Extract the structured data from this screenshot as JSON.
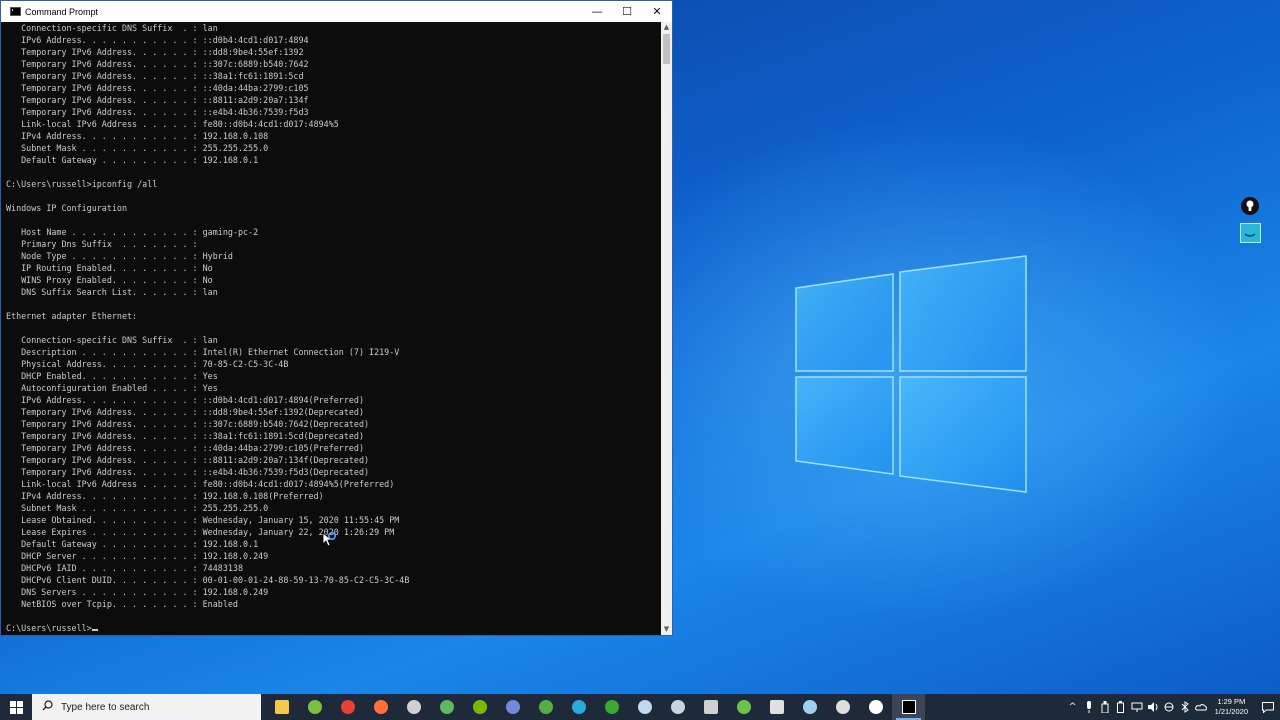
{
  "window": {
    "title": "Command Prompt",
    "minimize_glyph": "—",
    "maximize_glyph": "☐",
    "close_glyph": "✕"
  },
  "console_lines": [
    "   Connection-specific DNS Suffix  . : lan",
    "   IPv6 Address. . . . . . . . . . . : ::d0b4:4cd1:d017:4894",
    "   Temporary IPv6 Address. . . . . . : ::dd8:9be4:55ef:1392",
    "   Temporary IPv6 Address. . . . . . : ::307c:6889:b540:7642",
    "   Temporary IPv6 Address. . . . . . : ::38a1:fc61:1891:5cd",
    "   Temporary IPv6 Address. . . . . . : ::40da:44ba:2799:c105",
    "   Temporary IPv6 Address. . . . . . : ::8811:a2d9:20a7:134f",
    "   Temporary IPv6 Address. . . . . . : ::e4b4:4b36:7539:f5d3",
    "   Link-local IPv6 Address . . . . . : fe80::d0b4:4cd1:d017:4894%5",
    "   IPv4 Address. . . . . . . . . . . : 192.168.0.108",
    "   Subnet Mask . . . . . . . . . . . : 255.255.255.0",
    "   Default Gateway . . . . . . . . . : 192.168.0.1",
    "",
    "C:\\Users\\russell>ipconfig /all",
    "",
    "Windows IP Configuration",
    "",
    "   Host Name . . . . . . . . . . . . : gaming-pc-2",
    "   Primary Dns Suffix  . . . . . . . :",
    "   Node Type . . . . . . . . . . . . : Hybrid",
    "   IP Routing Enabled. . . . . . . . : No",
    "   WINS Proxy Enabled. . . . . . . . : No",
    "   DNS Suffix Search List. . . . . . : lan",
    "",
    "Ethernet adapter Ethernet:",
    "",
    "   Connection-specific DNS Suffix  . : lan",
    "   Description . . . . . . . . . . . : Intel(R) Ethernet Connection (7) I219-V",
    "   Physical Address. . . . . . . . . : 70-85-C2-C5-3C-4B",
    "   DHCP Enabled. . . . . . . . . . . : Yes",
    "   Autoconfiguration Enabled . . . . : Yes",
    "   IPv6 Address. . . . . . . . . . . : ::d0b4:4cd1:d017:4894(Preferred)",
    "   Temporary IPv6 Address. . . . . . : ::dd8:9be4:55ef:1392(Deprecated)",
    "   Temporary IPv6 Address. . . . . . : ::307c:6889:b540:7642(Deprecated)",
    "   Temporary IPv6 Address. . . . . . : ::38a1:fc61:1891:5cd(Deprecated)",
    "   Temporary IPv6 Address. . . . . . : ::40da:44ba:2799:c105(Preferred)",
    "   Temporary IPv6 Address. . . . . . : ::8811:a2d9:20a7:134f(Deprecated)",
    "   Temporary IPv6 Address. . . . . . : ::e4b4:4b36:7539:f5d3(Deprecated)",
    "   Link-local IPv6 Address . . . . . : fe80::d0b4:4cd1:d017:4894%5(Preferred)",
    "   IPv4 Address. . . . . . . . . . . : 192.168.0.108(Preferred)",
    "   Subnet Mask . . . . . . . . . . . : 255.255.255.0",
    "   Lease Obtained. . . . . . . . . . : Wednesday, January 15, 2020 11:55:45 PM",
    "   Lease Expires . . . . . . . . . . : Wednesday, January 22, 2020 1:26:29 PM",
    "   Default Gateway . . . . . . . . . : 192.168.0.1",
    "   DHCP Server . . . . . . . . . . . : 192.168.0.249",
    "   DHCPv6 IAID . . . . . . . . . . . : 74483138",
    "   DHCPv6 Client DUID. . . . . . . . : 00-01-00-01-24-88-59-13-70-85-C2-C5-3C-4B",
    "   DNS Servers . . . . . . . . . . . : 192.168.0.249",
    "   NetBIOS over Tcpip. . . . . . . . : Enabled",
    "",
    "C:\\Users\\russell>"
  ],
  "taskbar": {
    "search_placeholder": "Type here to search",
    "apps": [
      {
        "name": "file-explorer-icon",
        "color": "#f2c94c"
      },
      {
        "name": "notepad-plus-icon",
        "color": "#7bc043"
      },
      {
        "name": "chrome-icon",
        "color": "#e94235"
      },
      {
        "name": "firefox-icon",
        "color": "#ff7139"
      },
      {
        "name": "obs-icon",
        "color": "#d0d0d0"
      },
      {
        "name": "text-editor-icon",
        "color": "#5fb85f"
      },
      {
        "name": "nvidia-icon",
        "color": "#76b900"
      },
      {
        "name": "discord-icon",
        "color": "#7289da"
      },
      {
        "name": "xbox-icon",
        "color": "#52b043"
      },
      {
        "name": "g-app-icon",
        "color": "#2aa8e0"
      },
      {
        "name": "green-app-icon",
        "color": "#3aaa35"
      },
      {
        "name": "affinity-icon",
        "color": "#c0d8f0"
      },
      {
        "name": "steam-icon",
        "color": "#c6d4df"
      },
      {
        "name": "printer-icon",
        "color": "#d0d0d0"
      },
      {
        "name": "leaf-app-icon",
        "color": "#6cc24a"
      },
      {
        "name": "display-icon",
        "color": "#e0e0e0"
      },
      {
        "name": "globe-app-icon",
        "color": "#9fd0ef"
      },
      {
        "name": "unity-icon",
        "color": "#dddddd"
      },
      {
        "name": "keyhole-app-icon",
        "color": "#ffffff"
      },
      {
        "name": "command-prompt-icon",
        "color": "#ffffff"
      }
    ],
    "time": "1:29 PM",
    "date": "1/21/2020"
  },
  "colors": {
    "console_bg": "#0c0c0c",
    "console_text": "#cccccc",
    "taskbar_bg": "#1e2a3a",
    "accent": "#2b5fb0"
  }
}
